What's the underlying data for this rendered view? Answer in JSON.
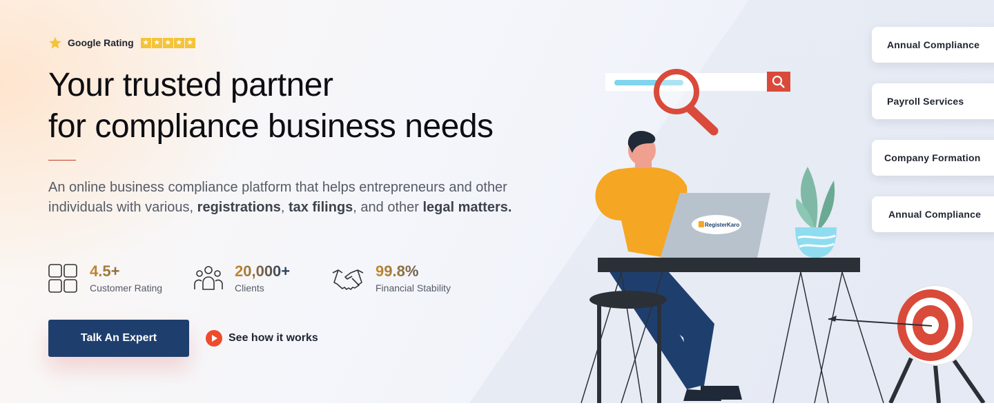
{
  "rating": {
    "label": "Google Rating",
    "stars": [
      "★",
      "★",
      "★",
      "★",
      "★"
    ],
    "star_icon": "star-icon"
  },
  "hero": {
    "headline_line1": "Your trusted partner",
    "headline_line2": "for compliance business needs",
    "description_part1": "An online business compliance platform that helps entrepreneurs and other individuals with various, ",
    "description_bold1": "registrations",
    "description_part2": ", ",
    "description_bold2": "tax filings",
    "description_part3": ", and other ",
    "description_bold3": "legal matters."
  },
  "stats": [
    {
      "value": "4.5+",
      "label": "Customer Rating",
      "icon": "grid-icon"
    },
    {
      "value": "20,000+",
      "label": "Clients",
      "icon": "users-icon"
    },
    {
      "value": "99.8%",
      "label": "Financial Stability",
      "icon": "handshake-icon"
    }
  ],
  "cta": {
    "primary_label": "Talk An Expert",
    "secondary_label": "See how it works",
    "secondary_icon": "play-icon"
  },
  "illustration": {
    "laptop_logo": "RegisterKaro"
  },
  "services": [
    {
      "label": "Annual Compliance"
    },
    {
      "label": "Payroll Services"
    },
    {
      "label": "Company Formation"
    },
    {
      "label": "Annual Compliance"
    }
  ],
  "colors": {
    "primary": "#1e3f6e",
    "accent": "#ee4b2b",
    "star": "#f5c339",
    "gradient_start": "#c98a2e"
  }
}
